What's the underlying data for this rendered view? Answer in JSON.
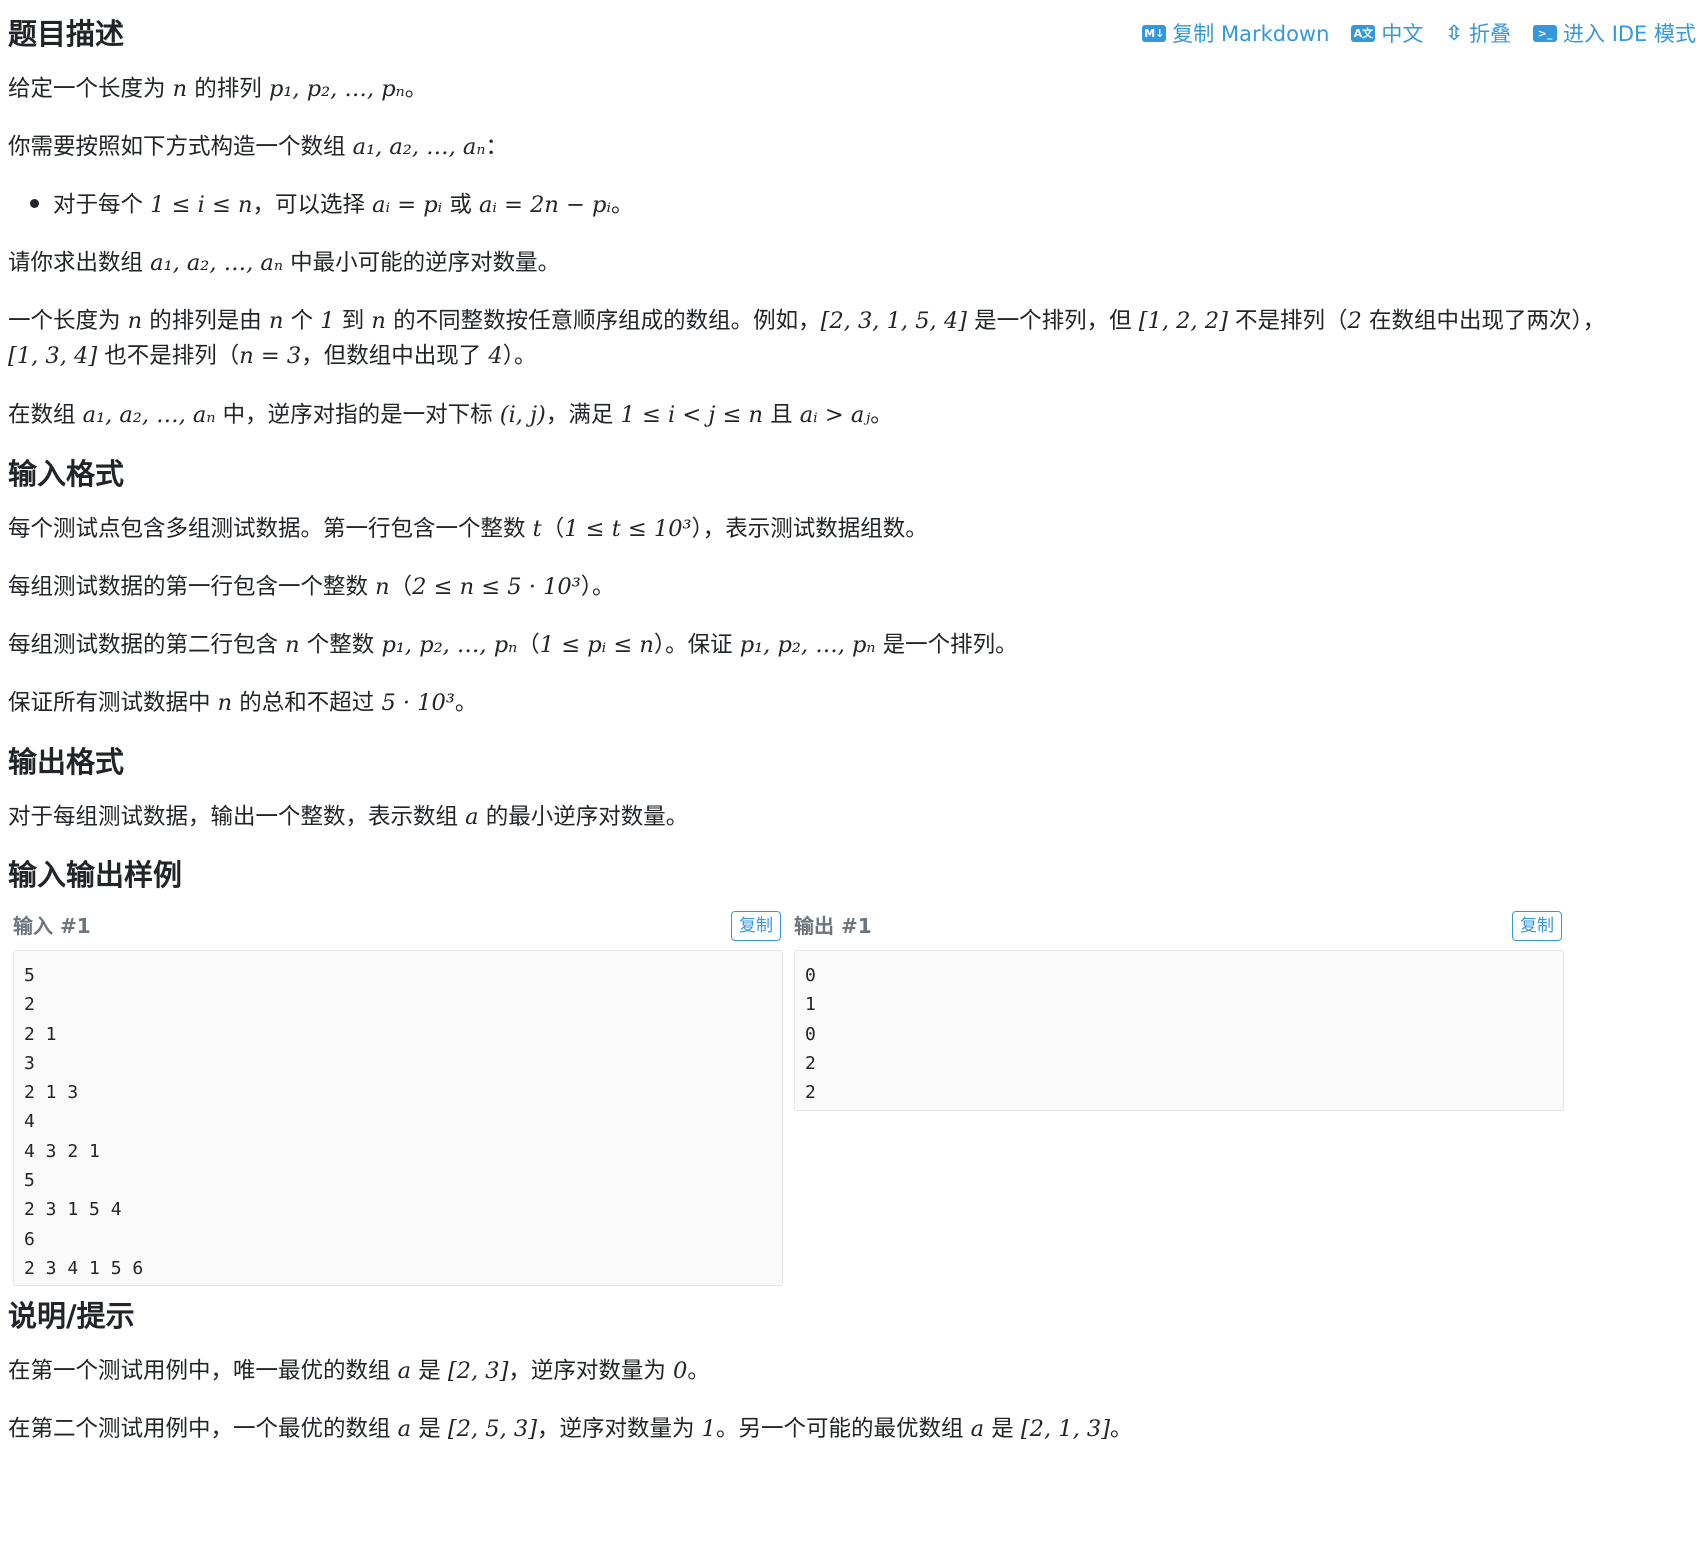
{
  "toolbar": {
    "copy_markdown": "复制 Markdown",
    "language": "中文",
    "fold": "折叠",
    "ide_mode": "进入 IDE 模式",
    "icons": [
      "markdown-icon",
      "translate-icon",
      "fold-icon",
      "terminal-icon"
    ]
  },
  "sections": {
    "description": "题目描述",
    "input_format": "输入格式",
    "output_format": "输出格式",
    "samples": "输入输出样例",
    "hint": "说明/提示"
  },
  "description": {
    "p1_a": "给定一个长度为 ",
    "p1_b": " 的排列 ",
    "p1_c": "。",
    "p2_a": "你需要按照如下方式构造一个数组 ",
    "p2_b": "：",
    "bullet_a": "对于每个 ",
    "bullet_b": "，可以选择 ",
    "bullet_c": " 或 ",
    "bullet_d": "。",
    "p3_a": "请你求出数组 ",
    "p3_b": " 中最小可能的逆序对数量。",
    "p4_a": "一个长度为 ",
    "p4_b": " 的排列是由 ",
    "p4_c": " 个 ",
    "p4_d": " 到 ",
    "p4_e": " 的不同整数按任意顺序组成的数组。例如，",
    "p4_f": " 是一个排列，但 ",
    "p4_g": " 不是排列（",
    "p4_h": " 在数组中出现了两次），",
    "p4_i": " 也不是排列（",
    "p4_j": "，但数组中出现了 ",
    "p4_k": "）。",
    "p5_a": "在数组 ",
    "p5_b": " 中，逆序对指的是一对下标 ",
    "p5_c": "，满足 ",
    "p5_d": " 且 ",
    "p5_e": "。"
  },
  "input_format": {
    "l1_a": "每个测试点包含多组测试数据。第一行包含一个整数 ",
    "l1_b": "（",
    "l1_c": "），表示测试数据组数。",
    "l2_a": "每组测试数据的第一行包含一个整数 ",
    "l2_b": "（",
    "l2_c": "）。",
    "l3_a": "每组测试数据的第二行包含 ",
    "l3_b": " 个整数 ",
    "l3_c": "（",
    "l3_d": "）。保证 ",
    "l3_e": " 是一个排列。",
    "l4_a": "保证所有测试数据中 ",
    "l4_b": " 的总和不超过 ",
    "l4_c": "。"
  },
  "output_format": {
    "l1_a": "对于每组测试数据，输出一个整数，表示数组 ",
    "l1_b": " 的最小逆序对数量。"
  },
  "math": {
    "n": "n",
    "p_seq": "p₁, p₂, …, pₙ",
    "a_seq": "a₁, a₂, …, aₙ",
    "i_range": "1 ≤ i ≤ n",
    "ai_pi": "aᵢ = pᵢ",
    "ai_2n": "aᵢ = 2n − pᵢ",
    "one": "1",
    "perm_ex": "[2, 3, 1, 5, 4]",
    "nonperm1": "[1, 2, 2]",
    "two": "2",
    "nonperm2": "[1, 3, 4]",
    "n_eq_3": "n = 3",
    "four": "4",
    "ij": "(i, j)",
    "ij_range": "1 ≤ i < j ≤ n",
    "ai_gt_aj": "aᵢ > aⱼ",
    "t": "t",
    "t_range": "1 ≤ t ≤ 10³",
    "n_range": "2 ≤ n ≤ 5 · 10³",
    "pi_range": "1 ≤ pᵢ ≤ n",
    "sum_limit": "5 · 10³",
    "a": "a",
    "arr_23": "[2, 3]",
    "zero": "0",
    "arr_253": "[2, 5, 3]",
    "arr_213": "[2, 1, 3]"
  },
  "samples": {
    "input_title": "输入 #1",
    "output_title": "输出 #1",
    "copy_label": "复制",
    "input_text": "5\n2\n2 1\n3\n2 1 3\n4\n4 3 2 1\n5\n2 3 1 5 4\n6\n2 3 4 1 5 6",
    "output_text": "0\n1\n0\n2\n2"
  },
  "hint": {
    "l1_a": "在第一个测试用例中，唯一最优的数组 ",
    "l1_b": " 是 ",
    "l1_c": "，逆序对数量为 ",
    "l1_d": "。",
    "l2_a": "在第二个测试用例中，一个最优的数组 ",
    "l2_b": " 是 ",
    "l2_c": "，逆序对数量为 ",
    "l2_d": "。另一个可能的最优数组 ",
    "l2_e": " 是 ",
    "l2_f": "。"
  },
  "colors": {
    "link": "#3498db",
    "text": "#212529",
    "muted": "#6c757d",
    "code_bg": "#fafafa"
  }
}
